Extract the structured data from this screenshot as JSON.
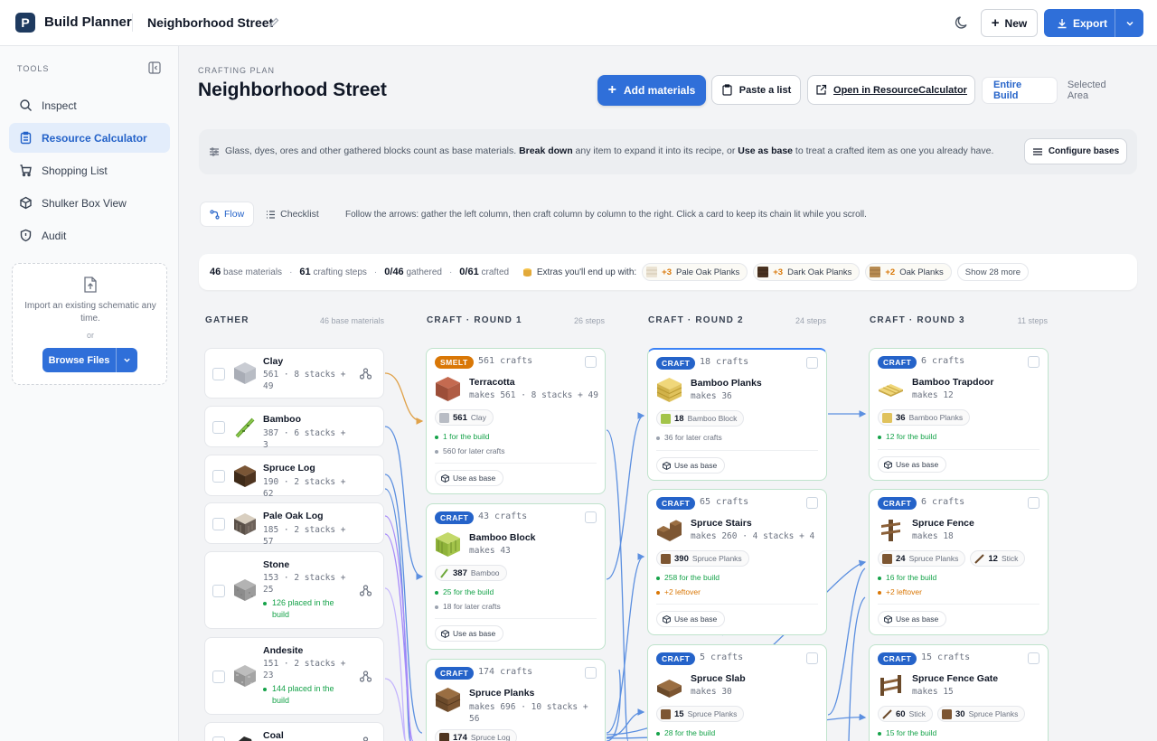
{
  "app": {
    "name": "Build Planner",
    "logo_letter": "P",
    "document_title": "Neighborhood Street"
  },
  "topbar": {
    "new_label": "New",
    "export_label": "Export"
  },
  "sidebar": {
    "section_label": "TOOLS",
    "items": [
      {
        "label": "Inspect",
        "icon": "search-icon"
      },
      {
        "label": "Resource Calculator",
        "icon": "clipboard-icon",
        "active": true
      },
      {
        "label": "Shopping List",
        "icon": "list-icon"
      },
      {
        "label": "Shulker Box View",
        "icon": "box-icon"
      },
      {
        "label": "Audit",
        "icon": "shield-icon"
      }
    ],
    "import": {
      "text": "Import an existing schematic any time.",
      "or": "or",
      "button": "Browse Files"
    }
  },
  "header": {
    "eyebrow": "CRAFTING PLAN",
    "title": "Neighborhood Street",
    "add_materials": "Add materials",
    "paste_list": "Paste a list",
    "open_external": "Open in ResourceCalculator",
    "scope_options": [
      "Entire Build",
      "Selected Area"
    ],
    "scope_selected": "Entire Build"
  },
  "info": {
    "text_a": "Glass, dyes, ores and other gathered blocks count as base materials. ",
    "bold_a": "Break down",
    "text_b": " any item to expand it into its recipe, or ",
    "bold_b": "Use as base",
    "text_c": " to treat a crafted item as one you already have.",
    "configure": "Configure bases"
  },
  "view": {
    "tabs": [
      "Flow",
      "Checklist"
    ],
    "active": "Flow",
    "hint": "Follow the arrows: gather the left column, then craft column by column to the right. Click a card to keep its chain lit while you scroll."
  },
  "stats": {
    "base_count": "46",
    "base_label": "base materials",
    "steps_count": "61",
    "steps_label": "crafting steps",
    "gathered": "0/46",
    "gathered_label": "gathered",
    "crafted": "0/61",
    "crafted_label": "crafted",
    "extras_label": "Extras you'll end up with:",
    "extras": [
      {
        "qty": "+3",
        "name": "Pale Oak Planks"
      },
      {
        "qty": "+3",
        "name": "Dark Oak Planks"
      },
      {
        "qty": "+2",
        "name": "Oak Planks"
      }
    ],
    "show_more": "Show 28 more"
  },
  "columns": [
    {
      "title": "GATHER",
      "sub": "46 base materials"
    },
    {
      "title": "CRAFT · ROUND 1",
      "sub": "26 steps"
    },
    {
      "title": "CRAFT · ROUND 2",
      "sub": "24 steps"
    },
    {
      "title": "CRAFT · ROUND 3",
      "sub": "11 steps"
    }
  ],
  "gather": [
    {
      "name": "Clay",
      "qty": "561 · 8 stacks + 49"
    },
    {
      "name": "Bamboo",
      "qty": "387 · 6 stacks + 3"
    },
    {
      "name": "Spruce Log",
      "qty": "190 · 2 stacks + 62"
    },
    {
      "name": "Pale Oak Log",
      "qty": "185 · 2 stacks + 57"
    },
    {
      "name": "Stone",
      "qty": "153 · 2 stacks + 25",
      "placed": "126 placed in the build"
    },
    {
      "name": "Andesite",
      "qty": "151 · 2 stacks + 23",
      "placed": "144 placed in the build"
    },
    {
      "name": "Coal",
      "qty": ""
    }
  ],
  "round1": [
    {
      "badge": "SMELT",
      "crafts": "561 crafts",
      "name": "Terracotta",
      "makes": "makes 561 · 8 stacks + 49",
      "inputs": [
        {
          "n": "561",
          "item": "Clay"
        }
      ],
      "notes": [
        "1 for the build",
        "560 for later crafts"
      ],
      "base": "Use as base"
    },
    {
      "badge": "CRAFT",
      "crafts": "43 crafts",
      "name": "Bamboo Block",
      "makes": "makes 43",
      "inputs": [
        {
          "n": "387",
          "item": "Bamboo"
        }
      ],
      "notes": [
        "25 for the build",
        "18 for later crafts"
      ],
      "base": "Use as base"
    },
    {
      "badge": "CRAFT",
      "crafts": "174 crafts",
      "name": "Spruce Planks",
      "makes": "makes 696 · 10 stacks + 56",
      "inputs": [
        {
          "n": "174",
          "item": "Spruce Log"
        }
      ]
    }
  ],
  "round2": [
    {
      "badge": "CRAFT",
      "crafts": "18 crafts",
      "name": "Bamboo Planks",
      "makes": "makes 36",
      "inputs": [
        {
          "n": "18",
          "item": "Bamboo Block"
        }
      ],
      "notes": [
        "36 for later crafts"
      ],
      "base": "Use as base"
    },
    {
      "badge": "CRAFT",
      "crafts": "65 crafts",
      "name": "Spruce Stairs",
      "makes": "makes 260 · 4 stacks + 4",
      "inputs": [
        {
          "n": "390",
          "item": "Spruce Planks"
        }
      ],
      "notes": [
        "258 for the build",
        "+2 leftover"
      ],
      "base": "Use as base"
    },
    {
      "badge": "CRAFT",
      "crafts": "5 crafts",
      "name": "Spruce Slab",
      "makes": "makes 30",
      "inputs": [
        {
          "n": "15",
          "item": "Spruce Planks"
        }
      ],
      "notes": [
        "28 for the build"
      ]
    }
  ],
  "round3": [
    {
      "badge": "CRAFT",
      "crafts": "6 crafts",
      "name": "Bamboo Trapdoor",
      "makes": "makes 12",
      "inputs": [
        {
          "n": "36",
          "item": "Bamboo Planks"
        }
      ],
      "notes": [
        "12 for the build"
      ],
      "base": "Use as base"
    },
    {
      "badge": "CRAFT",
      "crafts": "6 crafts",
      "name": "Spruce Fence",
      "makes": "makes 18",
      "inputs": [
        {
          "n": "24",
          "item": "Spruce Planks"
        },
        {
          "n": "12",
          "item": "Stick"
        }
      ],
      "notes": [
        "16 for the build",
        "+2 leftover"
      ],
      "base": "Use as base"
    },
    {
      "badge": "CRAFT",
      "crafts": "15 crafts",
      "name": "Spruce Fence Gate",
      "makes": "makes 15",
      "inputs": [
        {
          "n": "60",
          "item": "Stick"
        },
        {
          "n": "30",
          "item": "Spruce Planks"
        }
      ],
      "notes": [
        "15 for the build"
      ]
    }
  ],
  "colors": {
    "accent": "#2f6fd9",
    "craft_border": "#bfe3cc",
    "smelt": "#d97706",
    "success": "#16a34a",
    "flow_line": "#5b8fe0"
  }
}
